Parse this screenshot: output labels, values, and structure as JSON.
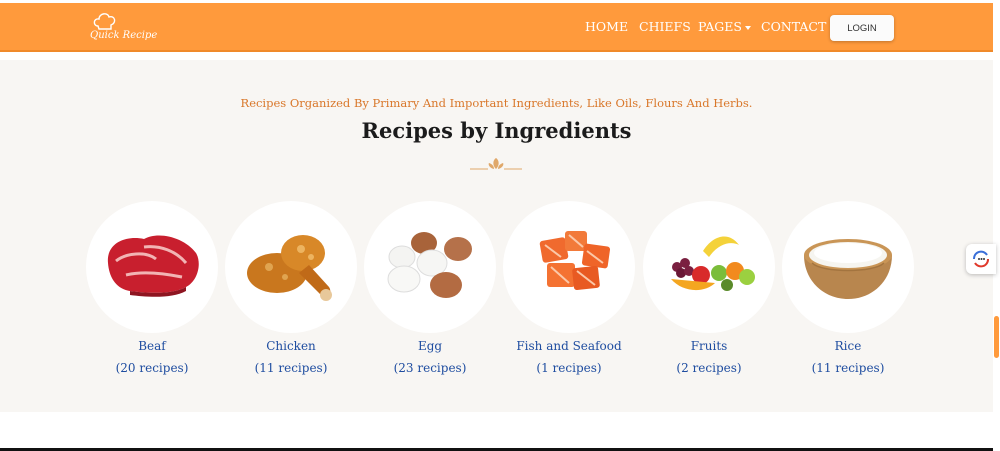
{
  "brand": {
    "logo_text": "Quick Recipe"
  },
  "nav": {
    "items": [
      {
        "label": "HOME"
      },
      {
        "label": "CHIEFS"
      },
      {
        "label": "PAGES"
      },
      {
        "label": "CONTACT"
      }
    ],
    "login_label": "LOGIN"
  },
  "section": {
    "subtitle": "Recipes Organized By Primary And Important Ingredients, Like Oils, Flours And Herbs.",
    "title": "Recipes by Ingredients"
  },
  "ingredients": [
    {
      "name": "Beaf",
      "count": "(20 recipes)",
      "icon": "beef-steak-image"
    },
    {
      "name": "Chicken",
      "count": "(11 recipes)",
      "icon": "fried-chicken-image"
    },
    {
      "name": "Egg",
      "count": "(23 recipes)",
      "icon": "eggs-image"
    },
    {
      "name": "Fish and Seafood",
      "count": "(1 recipes)",
      "icon": "salmon-image"
    },
    {
      "name": "Fruits",
      "count": "(2 recipes)",
      "icon": "fruits-image"
    },
    {
      "name": "Rice",
      "count": "(11 recipes)",
      "icon": "rice-bowl-image"
    }
  ],
  "colors": {
    "accent": "#ff9a3c",
    "subtitle": "#d9772a",
    "link": "#1f4da0",
    "section_bg": "#f8f6f3"
  }
}
